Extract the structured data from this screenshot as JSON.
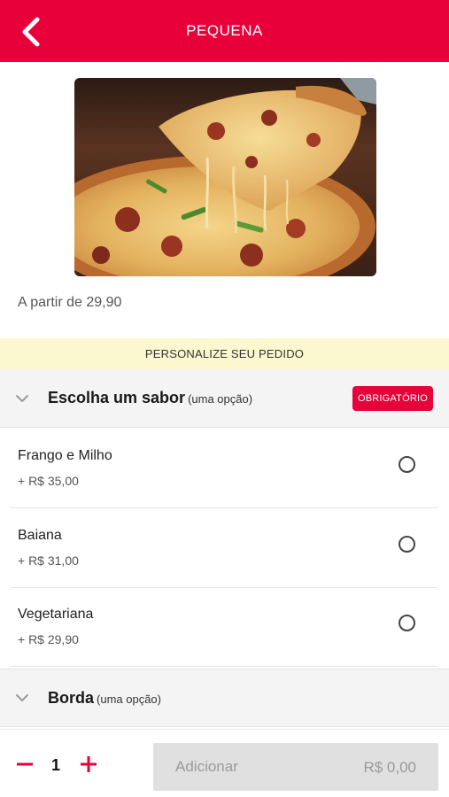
{
  "header": {
    "title": "PEQUENA",
    "back_icon": "chevron-left-icon",
    "color": "#e8003a"
  },
  "product": {
    "image": "pizza-photo",
    "price_from": "A partir de 29,90"
  },
  "customize_banner": "PERSONALIZE SEU PEDIDO",
  "sections": [
    {
      "title": "Escolha um sabor",
      "subtitle": "(uma opção)",
      "badge": "OBRIGATÓRIO",
      "expanded": true,
      "options": [
        {
          "name": "Frango e Milho",
          "price": "+ R$ 35,00",
          "selected": false
        },
        {
          "name": "Baiana",
          "price": "+ R$ 31,00",
          "selected": false
        },
        {
          "name": "Vegetariana",
          "price": "+ R$ 29,90",
          "selected": false
        }
      ]
    },
    {
      "title": "Borda",
      "subtitle": "(uma opção)",
      "expanded": false
    }
  ],
  "footer": {
    "quantity": "1",
    "add_label": "Adicionar",
    "total": "R$ 0,00",
    "minus_icon": "minus-icon",
    "plus_icon": "plus-icon"
  }
}
